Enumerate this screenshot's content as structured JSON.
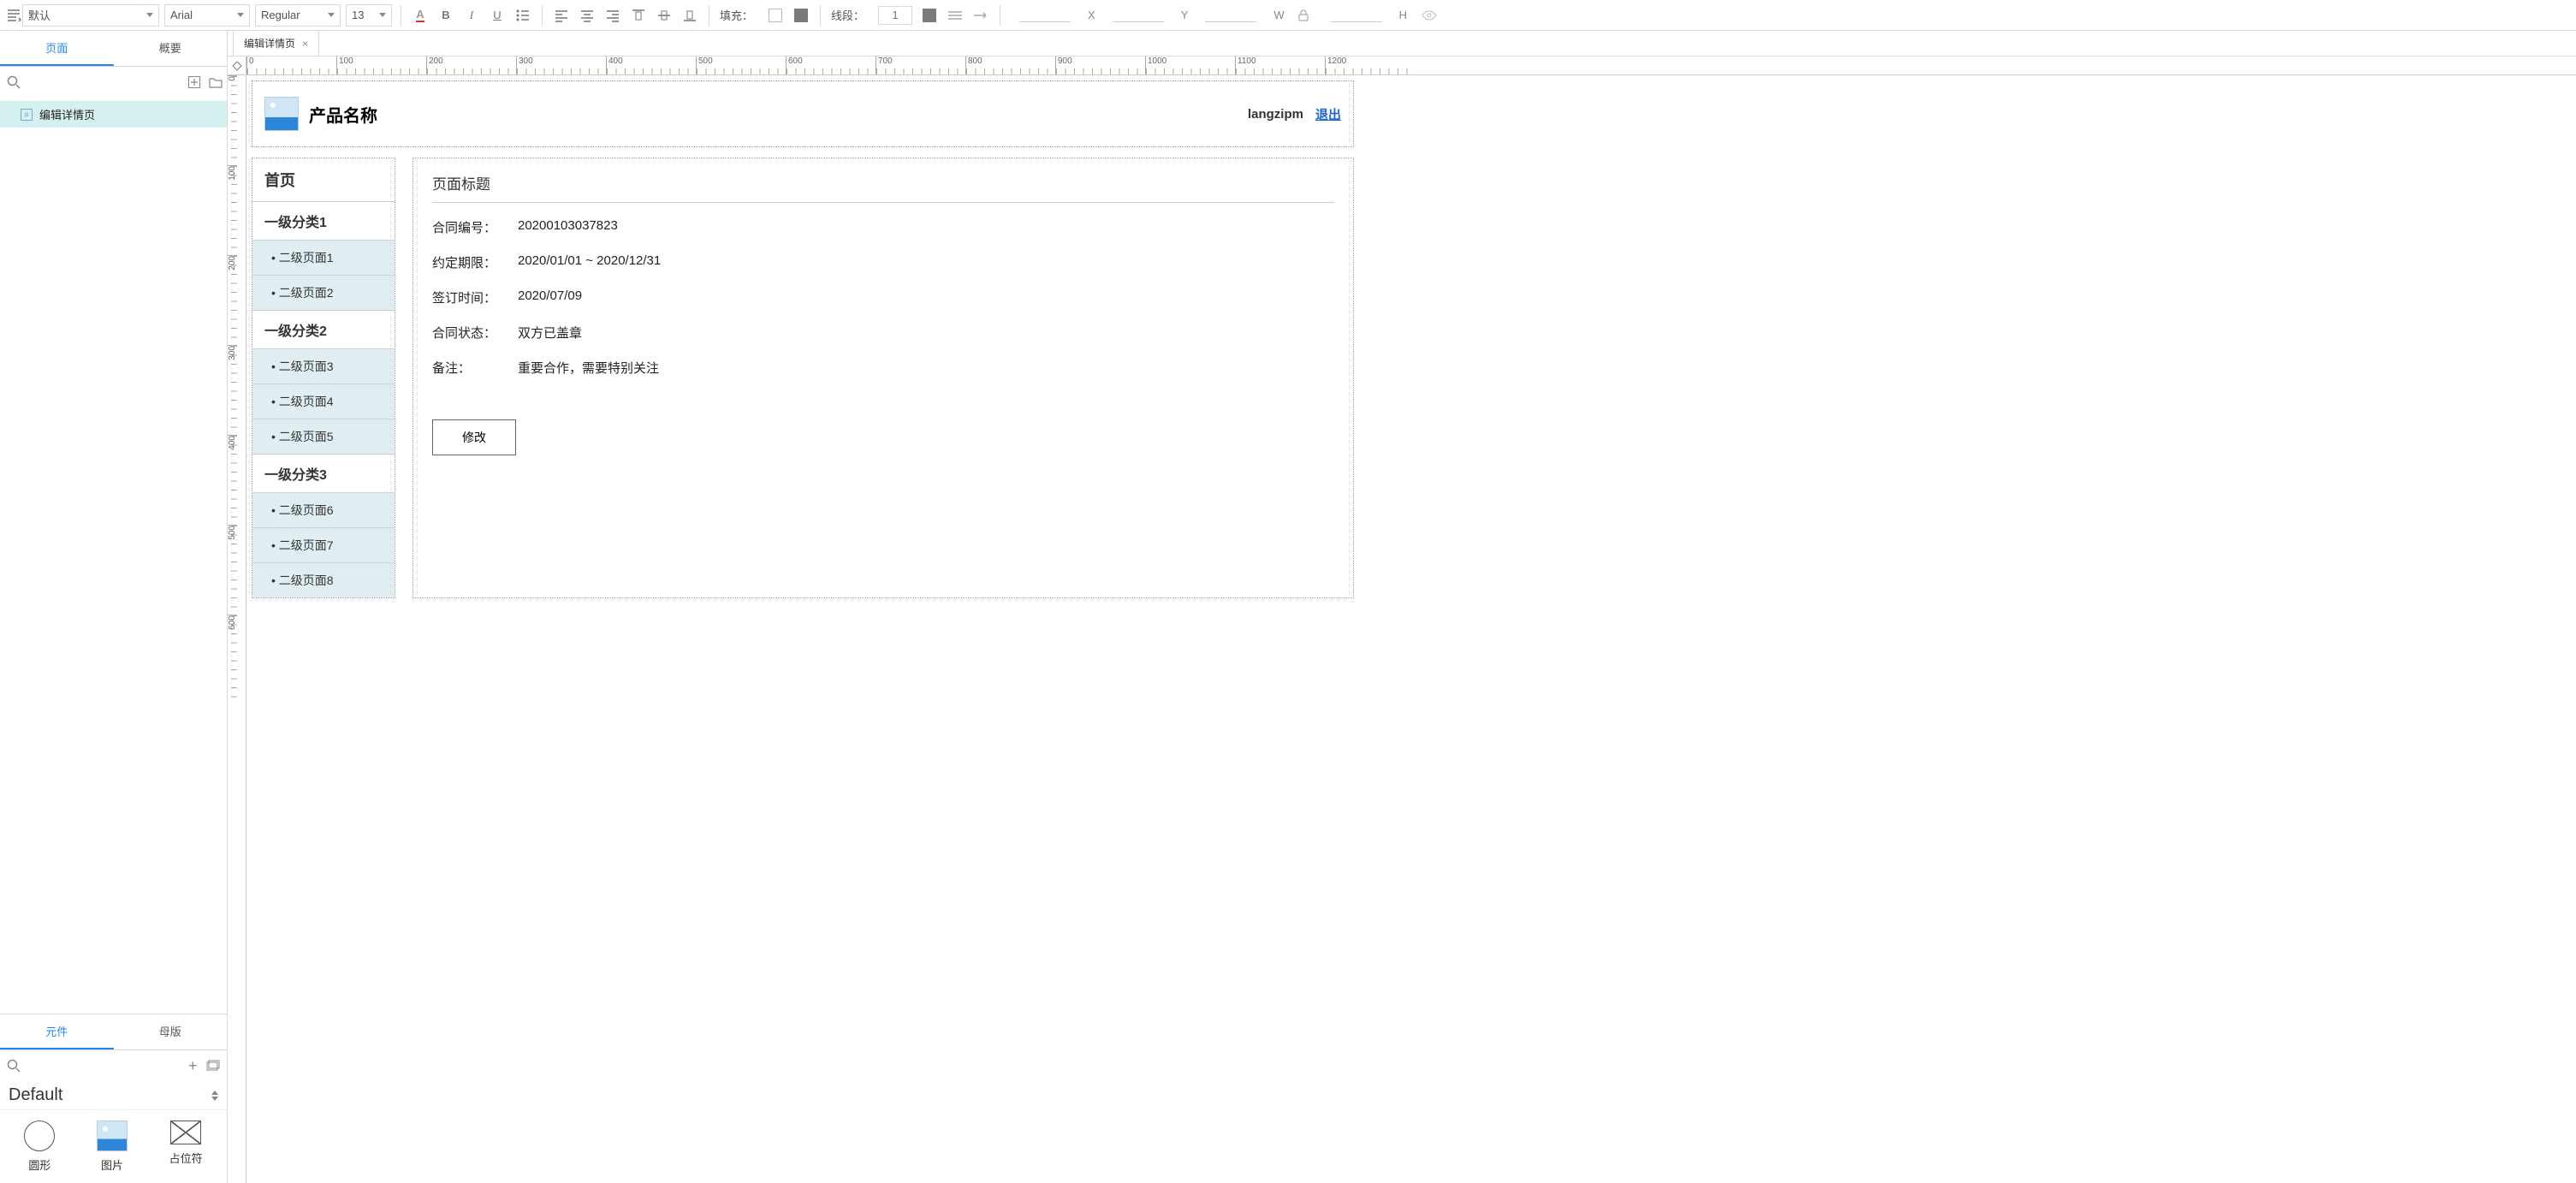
{
  "toolbar": {
    "style_preset": "默认",
    "font_family": "Arial",
    "font_weight": "Regular",
    "font_size": "13",
    "fill_label": "填充：",
    "line_label": "线段：",
    "line_width": "1",
    "coord": {
      "x_label": "X",
      "y_label": "Y",
      "w_label": "W",
      "h_label": "H"
    }
  },
  "left_panel": {
    "tabs": {
      "pages": "页面",
      "outline": "概要"
    },
    "pages": [
      {
        "title": "编辑详情页"
      }
    ],
    "comp_tabs": {
      "widgets": "元件",
      "masters": "母版"
    },
    "comp_library": "Default",
    "widgets": [
      "圆形",
      "图片",
      "占位符"
    ]
  },
  "canvas": {
    "tab_title": "编辑详情页",
    "ruler_h": [
      "0",
      "100",
      "200",
      "300",
      "400",
      "500",
      "600",
      "700",
      "800",
      "900",
      "1000",
      "1100",
      "1200"
    ],
    "ruler_v": [
      "0",
      "100",
      "200",
      "300",
      "400",
      "500",
      "600"
    ]
  },
  "mockup": {
    "header": {
      "product_name": "产品名称",
      "username": "langzipm",
      "logout": "退出"
    },
    "sidebar": {
      "home": "首页",
      "groups": [
        {
          "title": "一级分类1",
          "items": [
            "二级页面1",
            "二级页面2"
          ]
        },
        {
          "title": "一级分类2",
          "items": [
            "二级页面3",
            "二级页面4",
            "二级页面5"
          ]
        },
        {
          "title": "一级分类3",
          "items": [
            "二级页面6",
            "二级页面7",
            "二级页面8"
          ]
        }
      ]
    },
    "main": {
      "page_title": "页面标题",
      "fields": [
        {
          "label": "合同编号：",
          "value": "20200103037823"
        },
        {
          "label": "约定期限：",
          "value": "2020/01/01 ~ 2020/12/31"
        },
        {
          "label": "签订时间：",
          "value": "2020/07/09"
        },
        {
          "label": "合同状态：",
          "value": "双方已盖章"
        },
        {
          "label": "备注：",
          "value": "重要合作，需要特别关注"
        }
      ],
      "edit_button": "修改"
    }
  }
}
